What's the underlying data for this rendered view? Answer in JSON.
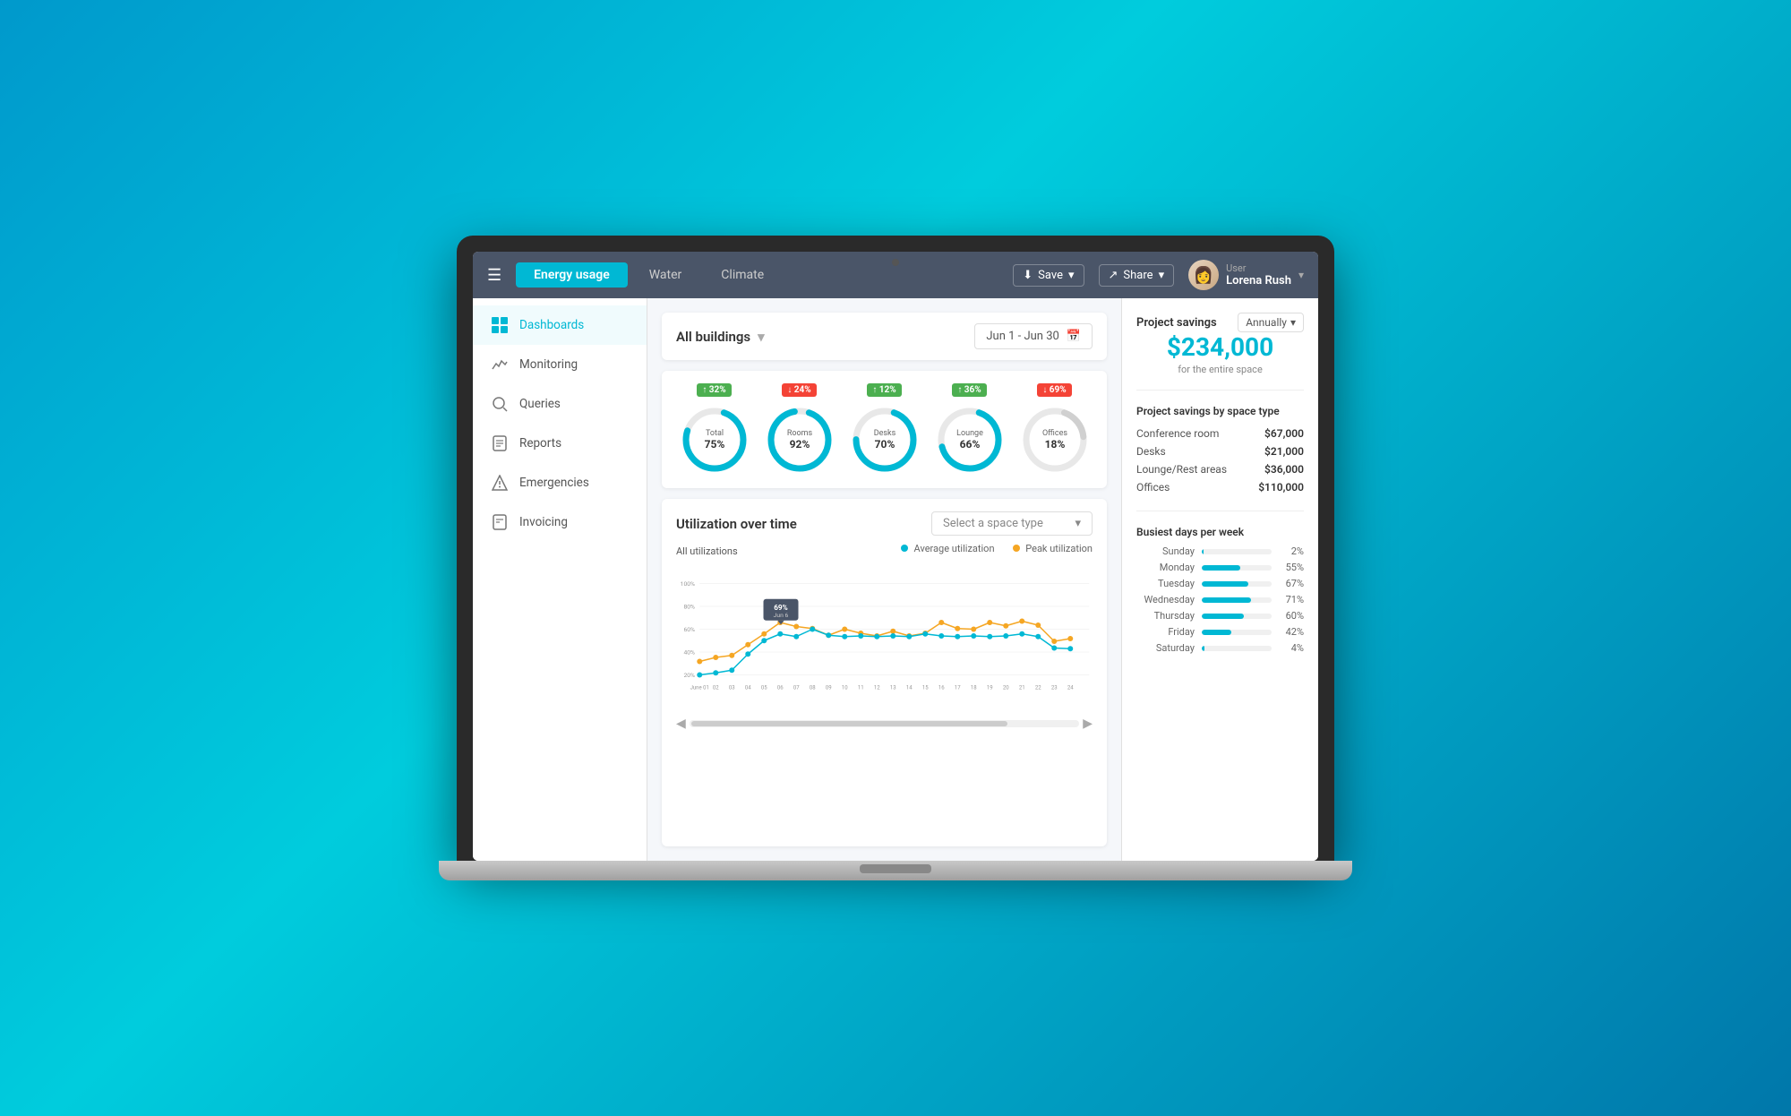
{
  "nav": {
    "tabs": [
      {
        "label": "Energy usage",
        "active": true
      },
      {
        "label": "Water",
        "active": false
      },
      {
        "label": "Climate",
        "active": false
      }
    ],
    "save_label": "Save",
    "share_label": "Share",
    "user": {
      "role": "User",
      "name": "Lorena Rush"
    }
  },
  "sidebar": {
    "items": [
      {
        "label": "Dashboards",
        "active": true
      },
      {
        "label": "Monitoring",
        "active": false
      },
      {
        "label": "Queries",
        "active": false
      },
      {
        "label": "Reports",
        "active": false
      },
      {
        "label": "Emergencies",
        "active": false
      },
      {
        "label": "Invoicing",
        "active": false
      }
    ]
  },
  "dashboard": {
    "buildings_label": "All buildings",
    "date_range": "Jun 1 - Jun 30",
    "donuts": [
      {
        "label": "Total",
        "percent": "75%",
        "badge": "↑ 32%",
        "badge_type": "up",
        "value": 75
      },
      {
        "label": "Rooms",
        "percent": "92%",
        "badge": "↓ 24%",
        "badge_type": "down",
        "value": 92
      },
      {
        "label": "Desks",
        "percent": "70%",
        "badge": "↑ 12%",
        "badge_type": "up",
        "value": 70
      },
      {
        "label": "Lounge",
        "percent": "66%",
        "badge": "↑ 36%",
        "badge_type": "up",
        "value": 66
      },
      {
        "label": "Offices",
        "percent": "18%",
        "badge": "↓ 69%",
        "badge_type": "down",
        "value": 18
      }
    ]
  },
  "utilization": {
    "title": "Utilization over time",
    "space_selector_placeholder": "Select a space type",
    "all_utilizations": "All utilizations",
    "legend": {
      "average": "Average utilization",
      "peak": "Peak utilization"
    },
    "y_axis": [
      "100%",
      "80%",
      "60%",
      "40%",
      "20%"
    ],
    "x_axis": [
      "June 01",
      "02",
      "03",
      "04",
      "05",
      "06",
      "07",
      "08",
      "09",
      "10",
      "11",
      "12",
      "13",
      "14",
      "15",
      "16",
      "17",
      "18",
      "19",
      "20",
      "21",
      "22",
      "23",
      "24"
    ],
    "tooltip": {
      "value": "69%",
      "date": "Jun 6"
    }
  },
  "right_panel": {
    "project_savings_title": "Project savings",
    "annually_label": "Annually",
    "savings_amount": "$234,000",
    "savings_subtitle": "for the entire space",
    "space_type_title": "Project savings by space type",
    "space_types": [
      {
        "label": "Conference room",
        "amount": "$67,000"
      },
      {
        "label": "Desks",
        "amount": "$21,000"
      },
      {
        "label": "Lounge/Rest areas",
        "amount": "$36,000"
      },
      {
        "label": "Offices",
        "amount": "$110,000"
      }
    ],
    "busiest_title": "Busiest days per week",
    "days": [
      {
        "label": "Sunday",
        "pct": 2,
        "display": "2%"
      },
      {
        "label": "Monday",
        "pct": 55,
        "display": "55%"
      },
      {
        "label": "Tuesday",
        "pct": 67,
        "display": "67%"
      },
      {
        "label": "Wednesday",
        "pct": 71,
        "display": "71%"
      },
      {
        "label": "Thursday",
        "pct": 60,
        "display": "60%"
      },
      {
        "label": "Friday",
        "pct": 42,
        "display": "42%"
      },
      {
        "label": "Saturday",
        "pct": 4,
        "display": "4%"
      }
    ]
  },
  "colors": {
    "primary": "#00b8d4",
    "accent_orange": "#f5a623",
    "sidebar_active": "#00b8d4",
    "nav_bg": "#4a5568"
  }
}
